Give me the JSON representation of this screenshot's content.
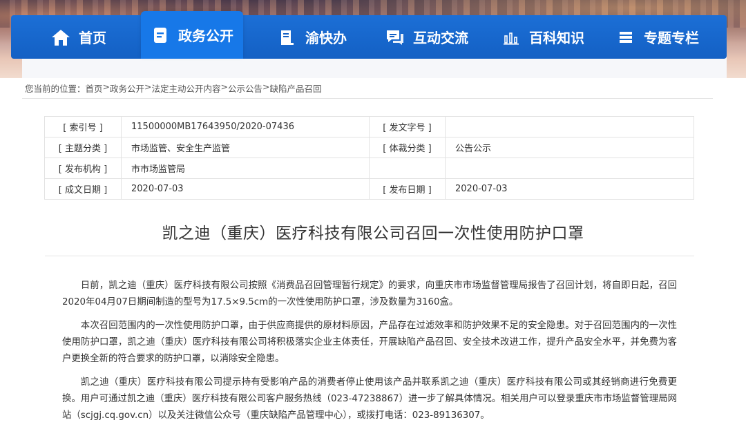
{
  "nav": {
    "items": [
      {
        "label": "首页",
        "icon": "home-icon"
      },
      {
        "label": "政务公开",
        "icon": "document-icon",
        "active": true
      },
      {
        "label": "渝快办",
        "icon": "book-icon"
      },
      {
        "label": "互动交流",
        "icon": "chat-icon"
      },
      {
        "label": "百科知识",
        "icon": "bar-chart-icon"
      },
      {
        "label": "专题专栏",
        "icon": "list-icon"
      }
    ]
  },
  "breadcrumb": {
    "prefix": "您当前的位置：",
    "items": [
      "首页",
      "政务公开",
      "法定主动公开内容",
      "公示公告",
      "缺陷产品召回"
    ],
    "separator": ">"
  },
  "meta": {
    "rows": [
      {
        "label1": "[ 索引号 ]",
        "value1": "11500000MB17643950/2020-07436",
        "label2": "[ 发文字号 ]",
        "value2": ""
      },
      {
        "label1": "[ 主题分类 ]",
        "value1": "市场监管、安全生产监管",
        "label2": "[ 体裁分类 ]",
        "value2": "公告公示"
      },
      {
        "label1": "[ 发布机构 ]",
        "value1": "市市场监管局",
        "label2": "",
        "value2": ""
      },
      {
        "label1": "[ 成文日期 ]",
        "value1": "2020-07-03",
        "label2": "[ 发布日期 ]",
        "value2": "2020-07-03"
      }
    ]
  },
  "article": {
    "title": "凯之迪（重庆）医疗科技有限公司召回一次性使用防护口罩",
    "paragraphs": [
      "日前，凯之迪（重庆）医疗科技有限公司按照《消费品召回管理暂行规定》的要求，向重庆市市场监督管理局报告了召回计划，将自即日起，召回2020年04月07日期间制造的型号为17.5×9.5cm的一次性使用防护口罩，涉及数量为3160盒。",
      "本次召回范围内的一次性使用防护口罩，由于供应商提供的原材料原因，产品存在过滤效率和防护效果不足的安全隐患。对于召回范围内的一次性使用防护口罩，凯之迪（重庆）医疗科技有限公司将积极落实企业主体责任，开展缺陷产品召回、安全技术改进工作，提升产品安全水平，并免费为客户更换全新的符合要求的防护口罩，以消除安全隐患。",
      "凯之迪（重庆）医疗科技有限公司提示持有受影响产品的消费者停止使用该产品并联系凯之迪（重庆）医疗科技有限公司或其经销商进行免费更换。用户可通过凯之迪（重庆）医疗科技有限公司客户服务热线（023-47238867）进一步了解具体情况。相关用户可以登录重庆市市场监督管理局网站（scjgj.cq.gov.cn）以及关注微信公众号（重庆缺陷产品管理中心），或拨打电话：023-89136307。"
    ]
  },
  "colors": {
    "nav_bg": "#1360c4",
    "nav_active": "#1778e8"
  }
}
